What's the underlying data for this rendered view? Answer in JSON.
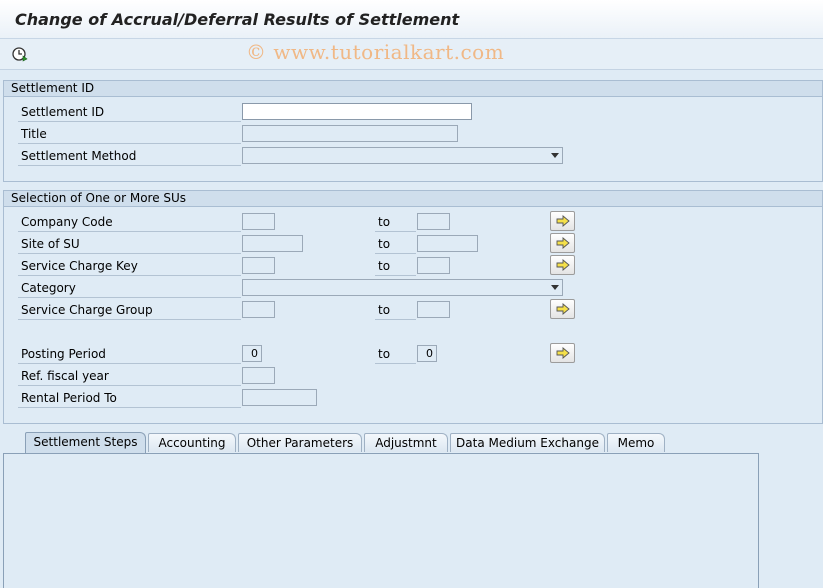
{
  "window": {
    "title": "Change of Accrual/Deferral Results of Settlement",
    "watermark": "© www.tutorialkart.com"
  },
  "toolbar": {
    "execute_icon": "execute-clock-icon"
  },
  "group_settlement": {
    "header": "Settlement ID",
    "settlement_id_label": "Settlement ID",
    "settlement_id_value": "",
    "title_label": "Title",
    "title_value": "",
    "method_label": "Settlement Method",
    "method_value": ""
  },
  "group_selection": {
    "header": "Selection of One or More SUs",
    "to_label": "to",
    "company_code_label": "Company Code",
    "site_label": "Site of SU",
    "service_charge_key_label": "Service Charge Key",
    "category_label": "Category",
    "service_charge_group_label": "Service Charge Group",
    "posting_period_label": "Posting Period",
    "posting_period_from": "0",
    "posting_period_to": "0",
    "fiscal_year_label": "Ref. fiscal year",
    "rental_period_label": "Rental Period To"
  },
  "tabs": [
    {
      "label": "Settlement Steps",
      "active": true
    },
    {
      "label": "Accounting",
      "active": false
    },
    {
      "label": "Other Parameters",
      "active": false
    },
    {
      "label": "Adjustmnt",
      "active": false
    },
    {
      "label": "Data Medium Exchange",
      "active": false
    },
    {
      "label": "Memo",
      "active": false
    }
  ],
  "colors": {
    "background": "#dfebf5",
    "group_header": "#cfdeec",
    "watermark": "#f0b886"
  }
}
